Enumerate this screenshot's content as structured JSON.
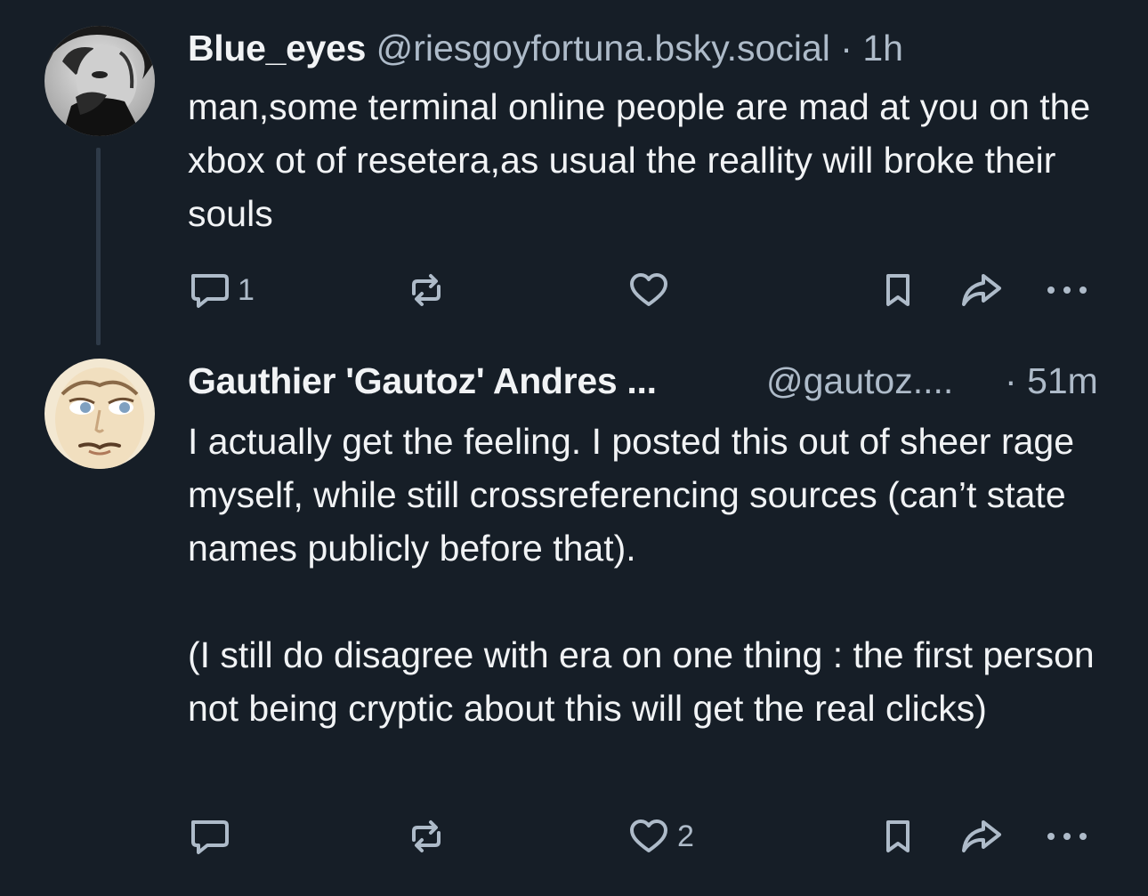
{
  "posts": [
    {
      "author": {
        "display_name": "Blue_eyes",
        "handle": "@riesgoyfortuna.bsky.social",
        "avatar": "grayscale-portrait-photo"
      },
      "time": "1h",
      "separator": "·",
      "text_paragraphs": [
        "man,some terminal online people are mad at you on the xbox ot of resetera,as usual the reallity will broke their souls"
      ],
      "actions": {
        "reply_icon": "reply-bubble-icon",
        "reply_count": "1",
        "repost_icon": "repost-icon",
        "repost_count": "",
        "like_icon": "heart-icon",
        "like_count": "",
        "bookmark_icon": "bookmark-icon",
        "share_icon": "share-arrow-icon",
        "more_icon": "more-dots-icon"
      }
    },
    {
      "author": {
        "display_name": "Gauthier 'Gautoz' Andres ...",
        "handle": "@gautoz....",
        "avatar": "cartoon-face-illustration"
      },
      "time": "51m",
      "separator": "·",
      "text_paragraphs": [
        "I actually get the feeling. I posted this out of sheer rage myself, while still crossreferencing sources (can’t state names publicly before that).",
        "(I still do disagree with era on one thing : the first person not being cryptic about this will get the real clicks)"
      ],
      "actions": {
        "reply_icon": "reply-bubble-icon",
        "reply_count": "",
        "repost_icon": "repost-icon",
        "repost_count": "",
        "like_icon": "heart-icon",
        "like_count": "2",
        "bookmark_icon": "bookmark-icon",
        "share_icon": "share-arrow-icon",
        "more_icon": "more-dots-icon"
      }
    }
  ],
  "colors": {
    "background": "#161e27",
    "text_primary": "#f1f3f5",
    "text_secondary": "#aebbc9",
    "thread_line": "#2e3a48"
  }
}
